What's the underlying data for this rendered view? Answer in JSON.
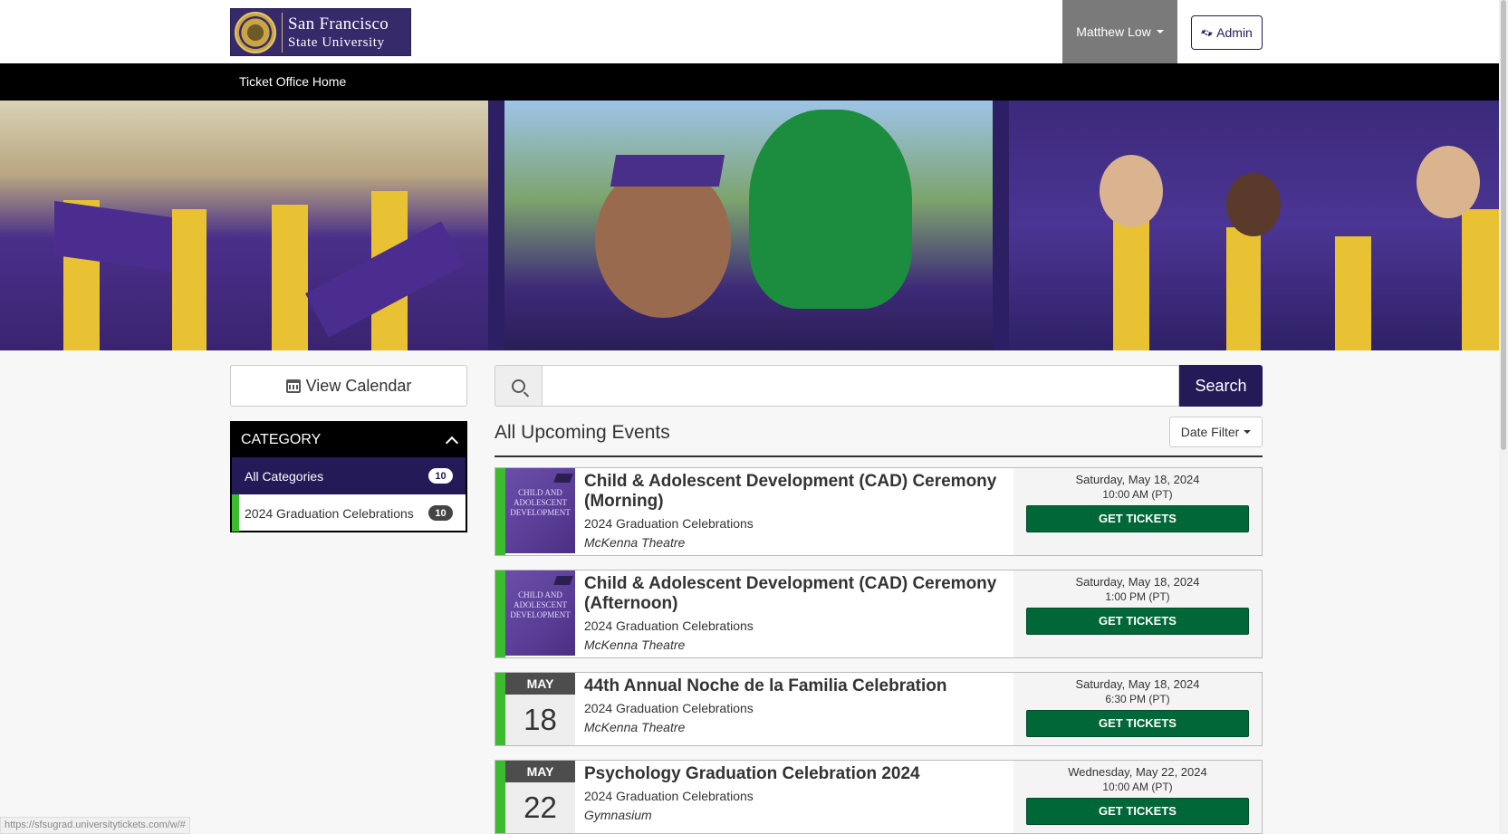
{
  "header": {
    "logo_line1": "San Francisco",
    "logo_line2": "State University",
    "user_name": "Matthew Low",
    "admin_label": "Admin"
  },
  "nav": {
    "home_label": "Ticket Office Home"
  },
  "sidebar": {
    "view_calendar_label": "View Calendar",
    "category_title": "CATEGORY",
    "categories": [
      {
        "label": "All Categories",
        "count": "10"
      },
      {
        "label": "2024 Graduation Celebrations",
        "count": "10"
      }
    ]
  },
  "search": {
    "placeholder": "",
    "button_label": "Search"
  },
  "main": {
    "heading": "All Upcoming Events",
    "date_filter_label": "Date Filter",
    "events": [
      {
        "title": "Child & Adolescent Development (CAD) Ceremony (Morning)",
        "category": "2024 Graduation Celebrations",
        "venue": "McKenna Theatre",
        "date": "Saturday, May 18, 2024",
        "time": "10:00 AM (PT)",
        "button": "GET TICKETS",
        "thumb_text": "CHILD AND ADOLESCENT DEVELOPMENT"
      },
      {
        "title": "Child & Adolescent Development (CAD) Ceremony (Afternoon)",
        "category": "2024 Graduation Celebrations",
        "venue": "McKenna Theatre",
        "date": "Saturday, May 18, 2024",
        "time": "1:00 PM (PT)",
        "button": "GET TICKETS",
        "thumb_text": "CHILD AND ADOLESCENT DEVELOPMENT"
      },
      {
        "title": "44th Annual Noche de la Familia Celebration",
        "category": "2024 Graduation Celebrations",
        "venue": "McKenna Theatre",
        "date": "Saturday, May 18, 2024",
        "time": "6:30 PM (PT)",
        "button": "GET TICKETS",
        "month": "MAY",
        "day": "18"
      },
      {
        "title": "Psychology Graduation Celebration 2024",
        "category": "2024 Graduation Celebrations",
        "venue": "Gymnasium",
        "date": "Wednesday, May 22, 2024",
        "time": "10:00 AM (PT)",
        "button": "GET TICKETS",
        "month": "MAY",
        "day": "22"
      }
    ]
  },
  "status_bar": {
    "url": "https://sfsugrad.universitytickets.com/w/#"
  },
  "colors": {
    "brand_purple": "#231a57",
    "ticket_green": "#006838",
    "category_green": "#3dbb2f"
  }
}
